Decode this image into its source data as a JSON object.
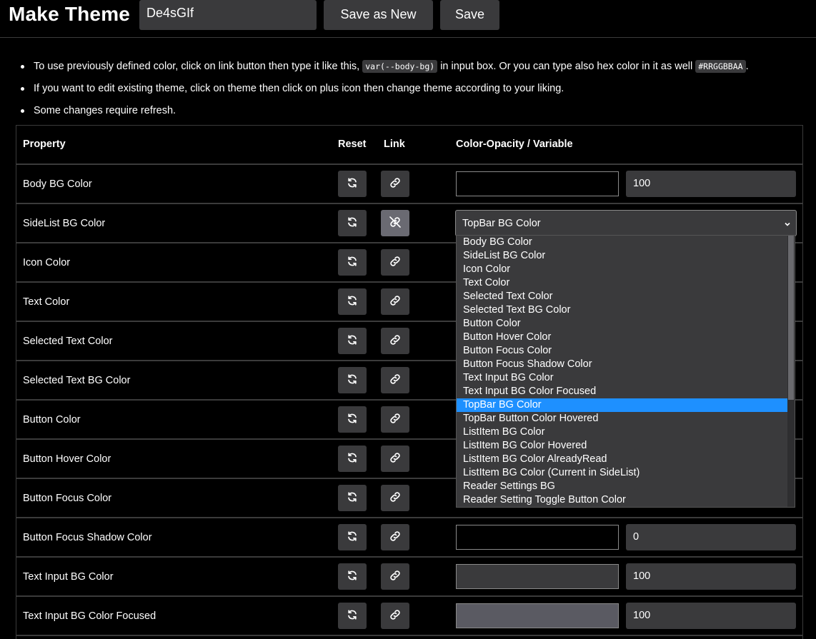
{
  "header": {
    "title": "Make Theme",
    "theme_name": "De4sGIf",
    "save_as_new_label": "Save as New",
    "save_label": "Save"
  },
  "notes": {
    "n1_pre": "To use previously defined color, click on link button then type it like this, ",
    "n1_code1": "var(--body-bg)",
    "n1_mid": " in input box. Or you can type also hex color in it as well ",
    "n1_code2": "#RRGGBBAA",
    "n1_post": ".",
    "n2": "If you want to edit existing theme, click on theme then click on plus icon then change theme according to your liking.",
    "n3": "Some changes require refresh."
  },
  "table": {
    "headers": {
      "property": "Property",
      "reset": "Reset",
      "link": "Link",
      "color": "Color-Opacity / Variable"
    },
    "rows": [
      {
        "label": "Body BG Color",
        "color": "#000000",
        "opacity": "100"
      },
      {
        "label": "SideList BG Color",
        "select_value": "TopBar BG Color"
      },
      {
        "label": "Icon Color"
      },
      {
        "label": "Text Color"
      },
      {
        "label": "Selected Text Color"
      },
      {
        "label": "Selected Text BG Color"
      },
      {
        "label": "Button Color"
      },
      {
        "label": "Button Hover Color"
      },
      {
        "label": "Button Focus Color"
      },
      {
        "label": "Button Focus Shadow Color",
        "color": "#000000",
        "opacity": "0"
      },
      {
        "label": "Text Input BG Color",
        "color": "#3a3a3c",
        "opacity": "100"
      },
      {
        "label": "Text Input BG Color Focused",
        "color": "#5a5a62",
        "opacity": "100"
      }
    ]
  },
  "dropdown": {
    "options": [
      "Body BG Color",
      "SideList BG Color",
      "Icon Color",
      "Text Color",
      "Selected Text Color",
      "Selected Text BG Color",
      "Button Color",
      "Button Hover Color",
      "Button Focus Color",
      "Button Focus Shadow Color",
      "Text Input BG Color",
      "Text Input BG Color Focused",
      "TopBar BG Color",
      "TopBar Button Color Hovered",
      "ListItem BG Color",
      "ListItem BG Color Hovered",
      "ListItem BG Color AlreadyRead",
      "ListItem BG Color (Current in SideList)",
      "Reader Settings BG",
      "Reader Setting Toggle Button Color"
    ],
    "selected": "TopBar BG Color"
  },
  "colors": {
    "background": "#000000",
    "control": "#3a3a3c",
    "highlight": "#1e90ff",
    "border": "#3b3b3b"
  },
  "icons": {
    "reset": "refresh-icon",
    "link": "link-icon",
    "unlink": "unlink-icon",
    "chevron": "chevron-down-icon"
  }
}
